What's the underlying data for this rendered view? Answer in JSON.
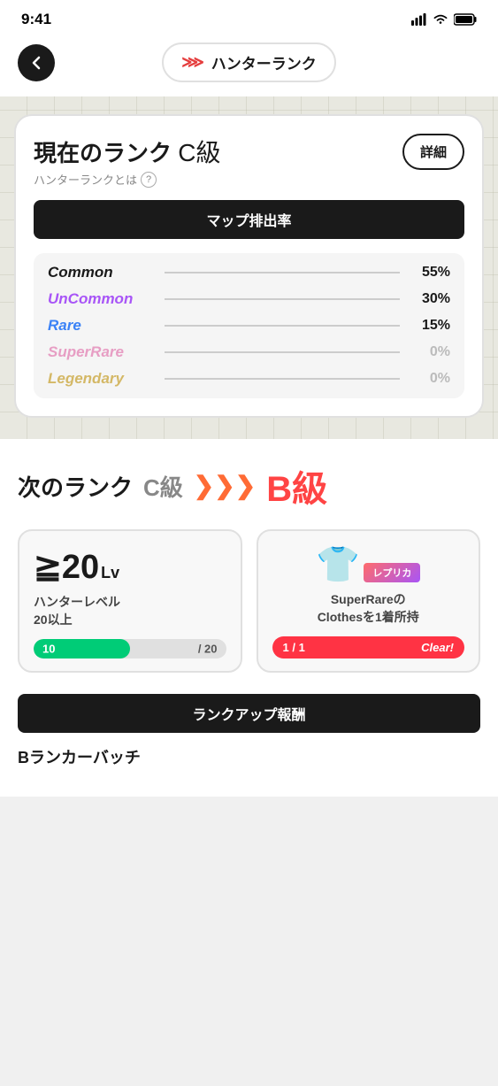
{
  "statusBar": {
    "time": "9:41",
    "signal": "●●●●",
    "wifi": "wifi",
    "battery": "battery"
  },
  "header": {
    "backLabel": "←",
    "titleIcon": "≫",
    "titleText": "ハンターランク"
  },
  "rankCard": {
    "currentRankLabel": "現在のランク",
    "currentRankGrade": "C級",
    "subtitleText": "ハンターランクとは",
    "detailButtonLabel": "詳細",
    "mapRateLabel": "マップ排出率",
    "rarities": [
      {
        "name": "Common",
        "color": "common",
        "pct": "55%",
        "dimmed": false
      },
      {
        "name": "UnCommon",
        "color": "uncommon",
        "pct": "30%",
        "dimmed": false
      },
      {
        "name": "Rare",
        "color": "rare",
        "pct": "15%",
        "dimmed": false
      },
      {
        "name": "SuperRare",
        "color": "superrare",
        "pct": "0%",
        "dimmed": true
      },
      {
        "name": "Legendary",
        "color": "legendary",
        "pct": "0%",
        "dimmed": true
      }
    ]
  },
  "nextRank": {
    "label": "次のランク",
    "fromGrade": "C級",
    "arrowText": "≫≫≫",
    "toGrade": "B級",
    "conditions": [
      {
        "type": "level",
        "icon": "≧20",
        "iconSuffix": "Lv",
        "desc": "ハンターレベル\n20以上",
        "progressCurrent": 10,
        "progressMax": 20,
        "progressText": "10 / 20",
        "progressPct": 50
      },
      {
        "type": "item",
        "badge": "レプリカ",
        "itemIcon": "👕",
        "desc": "SuperRareの\nClothesを1着所持",
        "countCurrent": 1,
        "countMax": 1,
        "clearLabel": "Clear!"
      }
    ],
    "rewardLabel": "ランクアップ報酬",
    "rewardItem": "Bランカーバッチ"
  }
}
